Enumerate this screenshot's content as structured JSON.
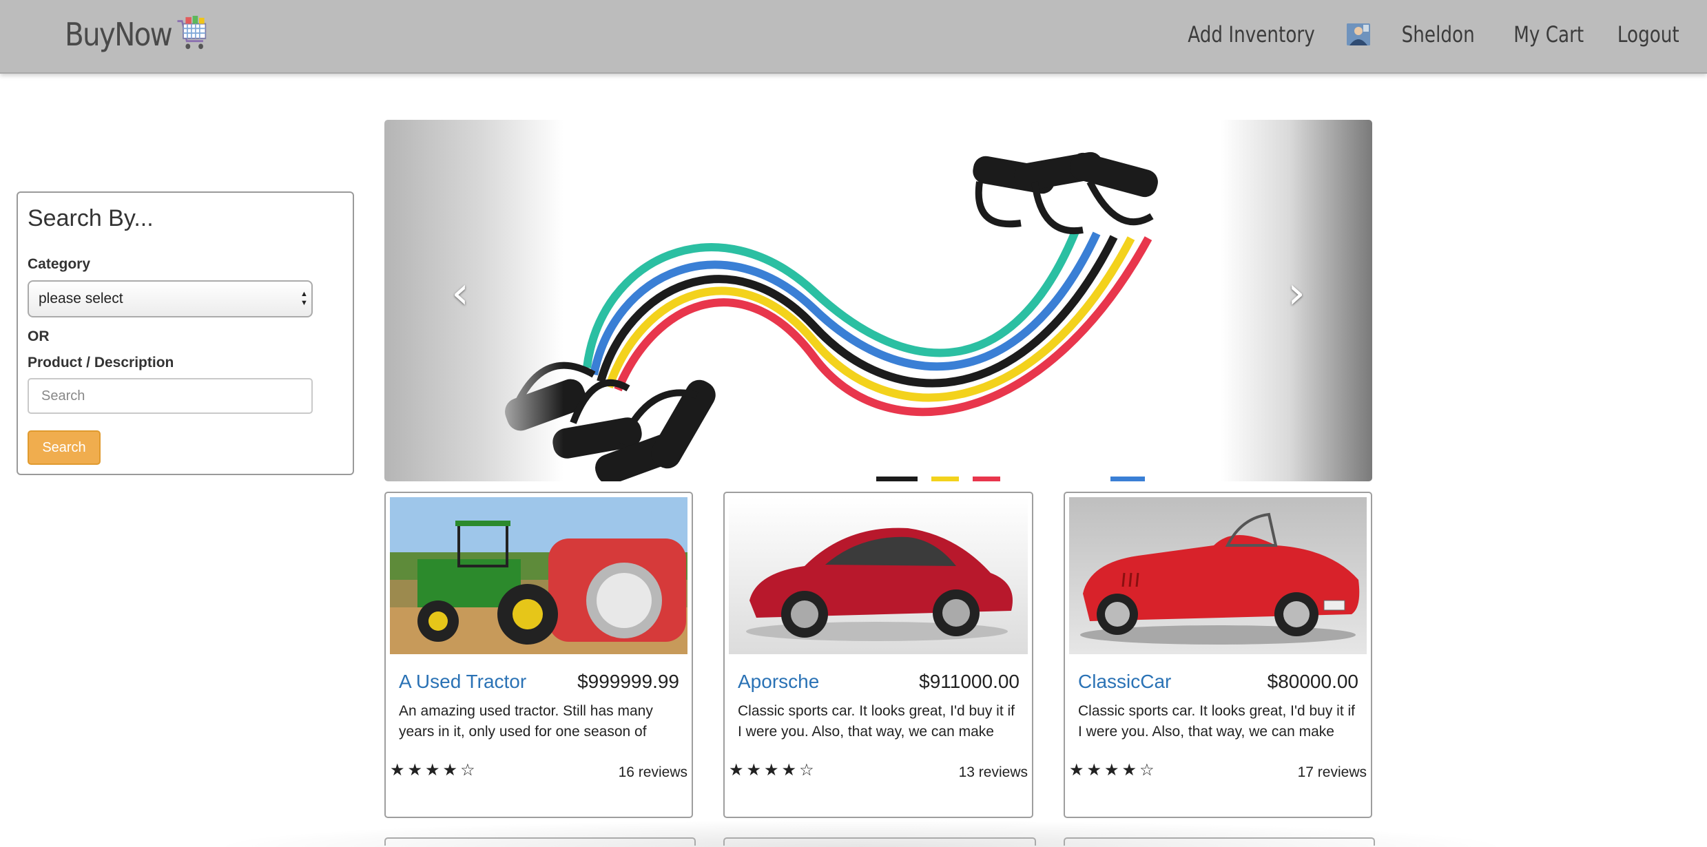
{
  "brand": {
    "name": "BuyNow",
    "logo_icon": "shopping-cart-icon"
  },
  "nav": {
    "add_inventory": "Add Inventory",
    "user_name": "Sheldon",
    "my_cart": "My Cart",
    "logout": "Logout"
  },
  "search_panel": {
    "title": "Search By...",
    "category_label": "Category",
    "category_selected": "please select",
    "or_label": "OR",
    "product_label": "Product / Description",
    "search_placeholder": "Search",
    "search_button": "Search"
  },
  "carousel": {
    "prev_icon": "chevron-left-icon",
    "next_icon": "chevron-right-icon",
    "prev_glyph": "‹",
    "next_glyph": "›"
  },
  "products": [
    {
      "name": "A Used Tractor",
      "price": "$999999.99",
      "description": "An amazing used tractor. Still has many years in it, only used for one season of",
      "stars": "★★★★☆",
      "rating": 4,
      "reviews": "16 reviews"
    },
    {
      "name": "Aporsche",
      "price": "$911000.00",
      "description": "Classic sports car. It looks great, I'd buy it if I were you. Also, that way, we can make",
      "stars": "★★★★☆",
      "rating": 4,
      "reviews": "13 reviews"
    },
    {
      "name": "ClassicCar",
      "price": "$80000.00",
      "description": "Classic sports car. It looks great, I'd buy it if I were you. Also, that way, we can make",
      "stars": "★★★★☆",
      "rating": 4,
      "reviews": "17 reviews"
    }
  ],
  "colors": {
    "navbar_bg": "#bcbcbc",
    "link_blue": "#2a72b5",
    "search_button": "#f0ad4e"
  }
}
